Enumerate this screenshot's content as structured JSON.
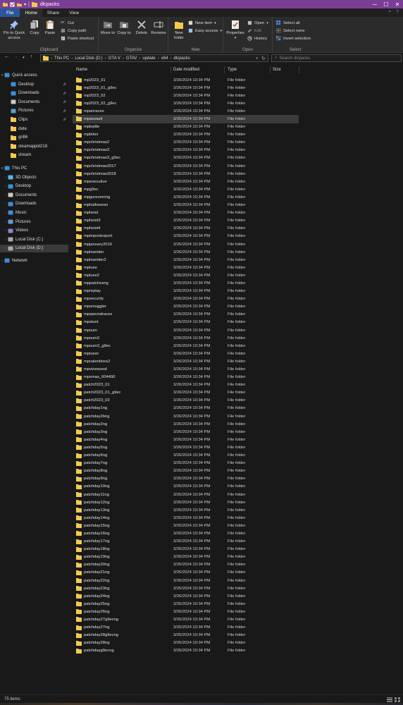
{
  "window": {
    "title": "dlcpacks",
    "tabs": [
      "File",
      "Home",
      "Share",
      "View"
    ]
  },
  "ribbon": {
    "clipboard": {
      "label": "Clipboard",
      "pin": "Pin to Quick access",
      "copy": "Copy",
      "paste": "Paste",
      "cut": "Cut",
      "copy_path": "Copy path",
      "paste_shortcut": "Paste shortcut"
    },
    "organize": {
      "label": "Organize",
      "move_to": "Move to",
      "copy_to": "Copy to",
      "delete": "Delete",
      "rename": "Rename"
    },
    "new": {
      "label": "New",
      "new_folder": "New folder",
      "new_item": "New item",
      "easy_access": "Easy access"
    },
    "open": {
      "label": "Open",
      "properties": "Properties",
      "open": "Open",
      "edit": "Edit",
      "history": "History"
    },
    "select": {
      "label": "Select",
      "select_all": "Select all",
      "select_none": "Select none",
      "invert_selection": "Invert selection"
    }
  },
  "address": {
    "crumbs": [
      "This PC",
      "Local Disk (D:)",
      "GTA V",
      "GTAV",
      "update",
      "x64",
      "dlcpacks"
    ],
    "search_placeholder": "Search dlcpacks"
  },
  "nav": {
    "quick_access": "Quick access",
    "quick_items": [
      "Desktop",
      "Downloads",
      "Documents",
      "Pictures",
      "Clips",
      "data",
      "gri86",
      "steamappid218",
      "stream"
    ],
    "this_pc": "This PC",
    "pc_items": [
      "3D Objects",
      "Desktop",
      "Documents",
      "Downloads",
      "Music",
      "Pictures",
      "Videos",
      "Local Disk (C:)",
      "Local Disk (D:)"
    ],
    "network": "Network"
  },
  "columns": {
    "name": "Name",
    "date": "Date modified",
    "type": "Type",
    "size": "Size"
  },
  "file_date": "3/26/2024 10:34 PM",
  "file_type": "File folder",
  "highlighted_index": 5,
  "files": [
    "mp2023_01",
    "mp2023_01_g9ec",
    "mp2023_02",
    "mp2023_02_g9ec",
    "mpairraces",
    "mpassault",
    "mpbattle",
    "mpbiker",
    "mpchristmas2",
    "mpchristmas3",
    "mpchristmas3_g9ec",
    "mpchristmas2017",
    "mpchristmas2018",
    "mpexecutive",
    "mpg9ec",
    "mpgunrunning",
    "mphalloween",
    "mpheist",
    "mpheist3",
    "mpheist4",
    "mpimportexport",
    "mpjanuary2016",
    "mplowrider",
    "mplowrider2",
    "mpluxe",
    "mpluxe2",
    "mppatchesng",
    "mpreplay",
    "mpsecurity",
    "mpsmuggler",
    "mpspecialraces",
    "mpstunt",
    "mpsum",
    "mpsum2",
    "mpsum2_g9ec",
    "mptuner",
    "mpvalentines2",
    "mpvinewood",
    "mpxmas_604490",
    "patch2023_01",
    "patch2023_01_g9ec",
    "patch2023_02",
    "patchday1ng",
    "patchday2bng",
    "patchday2ng",
    "patchday3ng",
    "patchday4ng",
    "patchday5ng",
    "patchday6ng",
    "patchday7ng",
    "patchday8ng",
    "patchday9ng",
    "patchday10ng",
    "patchday11ng",
    "patchday12ng",
    "patchday13ng",
    "patchday14ng",
    "patchday15ng",
    "patchday16ng",
    "patchday17ng",
    "patchday18ng",
    "patchday19ng",
    "patchday20ng",
    "patchday21ng",
    "patchday22ng",
    "patchday23ng",
    "patchday24ng",
    "patchday25ng",
    "patchday26ng",
    "patchday27g9ecng",
    "patchday27ng",
    "patchday28g9ecng",
    "patchday28ng",
    "patchdayg9ecng"
  ],
  "status": {
    "count": "75 items"
  },
  "colors": {
    "titlebar": "#7b3e96",
    "file_tab": "#2b579a",
    "folder": "#f3c94f"
  }
}
